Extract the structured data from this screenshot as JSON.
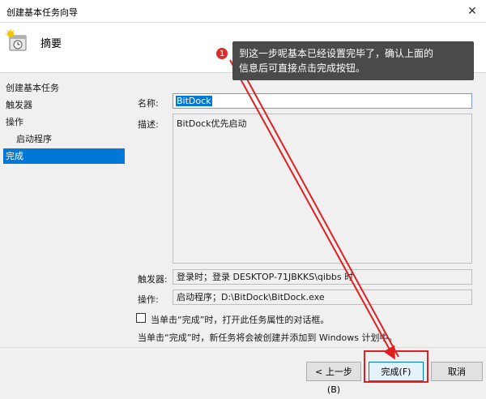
{
  "window": {
    "title": "创建基本任务向导",
    "close_glyph": "✕"
  },
  "header": {
    "title": "摘要"
  },
  "sidebar": {
    "items": [
      {
        "label": "创建基本任务"
      },
      {
        "label": "触发器"
      },
      {
        "label": "操作"
      },
      {
        "label": "启动程序"
      },
      {
        "label": "完成"
      }
    ]
  },
  "form": {
    "name_label": "名称:",
    "name_value": "BitDock",
    "desc_label": "描述:",
    "desc_value": "BitDock优先启动",
    "trigger_label": "触发器:",
    "trigger_value": "登录时；登录 DESKTOP-71JBKKS\\qibbs 时",
    "action_label": "操作:",
    "action_value": "启动程序；D:\\BitDock\\BitDock.exe",
    "checkbox_label": "当单击“完成”时，打开此任务属性的对话框。",
    "note": "当单击“完成”时，新任务将会被创建并添加到 Windows 计划中。"
  },
  "buttons": {
    "back": "< 上一步(B)",
    "finish": "完成(F)",
    "cancel": "取消"
  },
  "annotation": {
    "badge": "1",
    "line1": "到这一步呢基本已经设置完毕了，确认上面的",
    "line2": "信息后可直接点击完成按钮。"
  }
}
